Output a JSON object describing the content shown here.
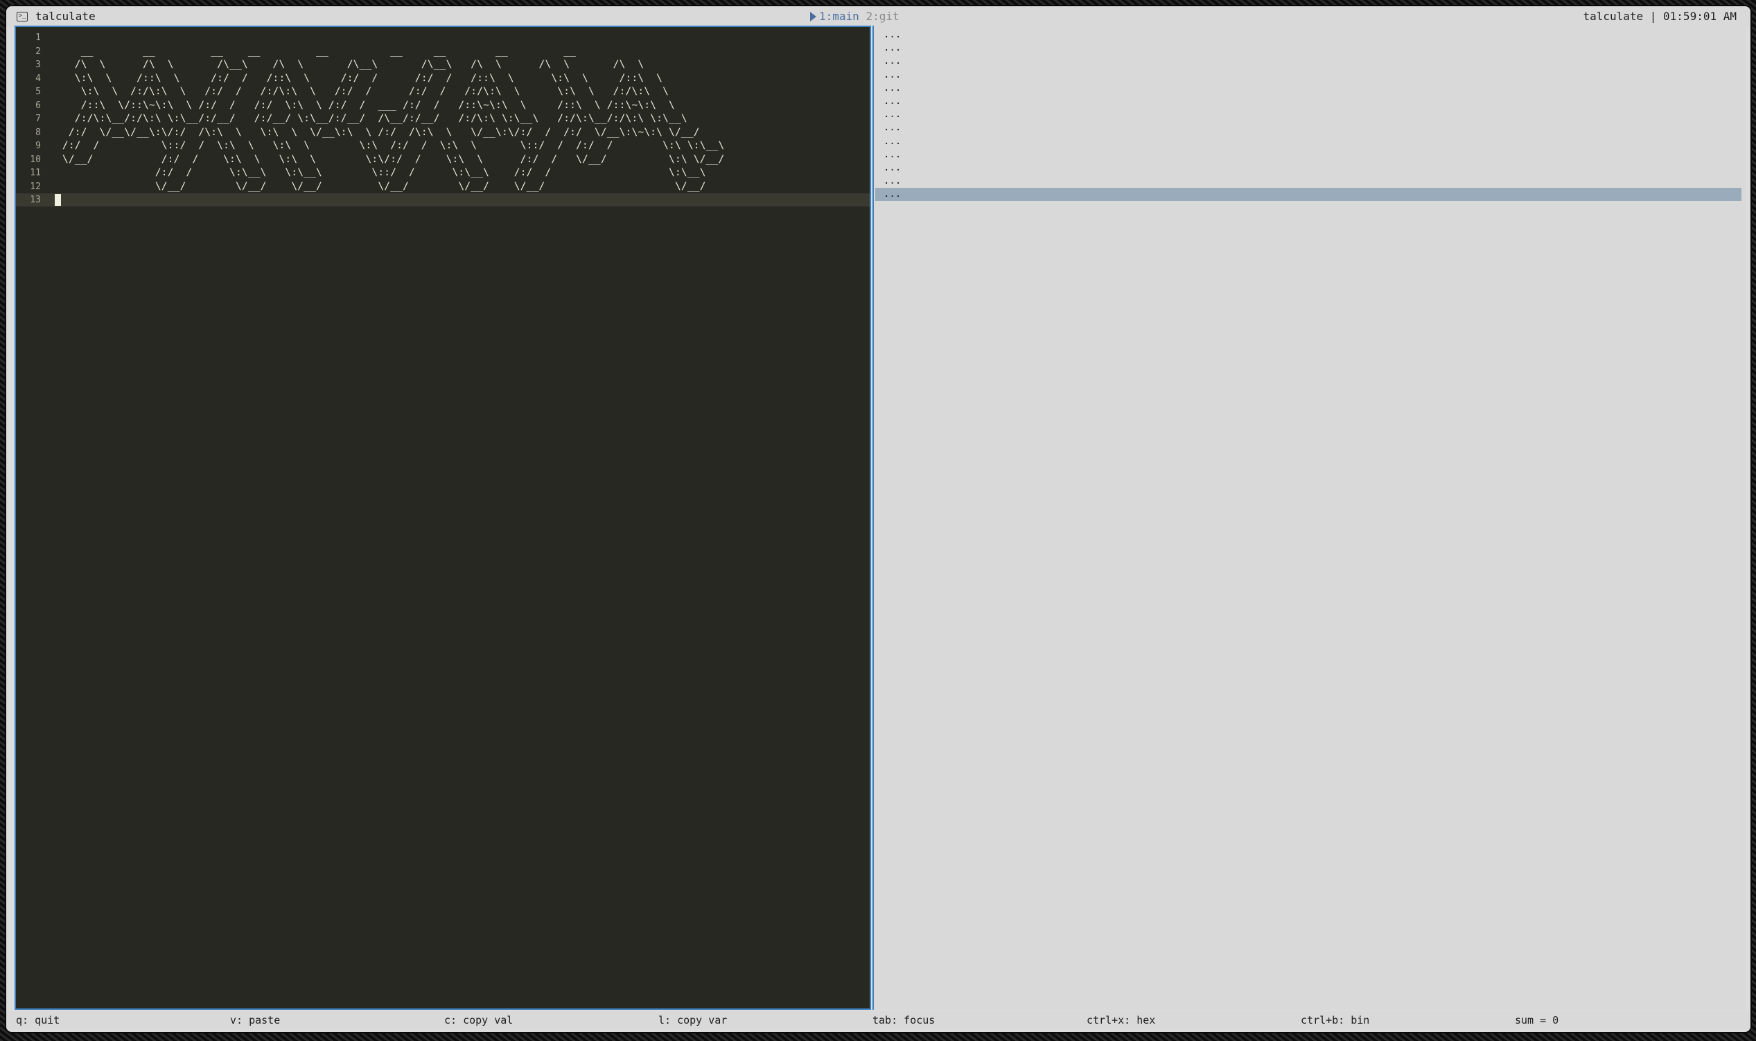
{
  "titlebar": {
    "title": "talculate",
    "tab_active": "1:main",
    "tab_inactive": "2:git",
    "right": "talculate | 01:59:01 AM"
  },
  "editor": {
    "lines": [
      {
        "num": "1",
        "text": ""
      },
      {
        "num": "2",
        "text": "    __        __         __    __         __          __     __        __         __"
      },
      {
        "num": "3",
        "text": "   /\\  \\      /\\  \\       /\\__\\    /\\  \\       /\\__\\       /\\__\\   /\\  \\      /\\  \\       /\\  \\"
      },
      {
        "num": "4",
        "text": "   \\:\\  \\    /::\\  \\     /:/  /   /::\\  \\     /:/  /      /:/  /   /::\\  \\      \\:\\  \\     /::\\  \\"
      },
      {
        "num": "5",
        "text": "    \\:\\  \\  /:/\\:\\  \\   /:/  /   /:/\\:\\  \\   /:/  /      /:/  /   /:/\\:\\  \\      \\:\\  \\   /:/\\:\\  \\"
      },
      {
        "num": "6",
        "text": "    /::\\  \\/::\\~\\:\\  \\ /:/  /   /:/  \\:\\  \\ /:/  /  ___ /:/  /   /::\\~\\:\\  \\     /::\\  \\ /::\\~\\:\\  \\"
      },
      {
        "num": "7",
        "text": "   /:/\\:\\__/:/\\:\\ \\:\\__/:/__/   /:/__/ \\:\\__/:/__/  /\\__/:/__/   /:/\\:\\ \\:\\__\\   /:/\\:\\__/:/\\:\\ \\:\\__\\"
      },
      {
        "num": "8",
        "text": "  /:/  \\/__\\/__\\:\\/:/  /\\:\\  \\   \\:\\  \\  \\/__\\:\\  \\ /:/  /\\:\\  \\   \\/__\\:\\/:/  /  /:/  \\/__\\:\\~\\:\\ \\/__/"
      },
      {
        "num": "9",
        "text": " /:/  /          \\::/  /  \\:\\  \\   \\:\\  \\        \\:\\  /:/  /  \\:\\  \\       \\::/  /  /:/  /        \\:\\ \\:\\__\\"
      },
      {
        "num": "10",
        "text": " \\/__/           /:/  /    \\:\\  \\   \\:\\  \\        \\:\\/:/  /    \\:\\  \\      /:/  /   \\/__/          \\:\\ \\/__/"
      },
      {
        "num": "11",
        "text": "                /:/  /      \\:\\__\\   \\:\\__\\        \\::/  /      \\:\\__\\    /:/  /                   \\:\\__\\"
      },
      {
        "num": "12",
        "text": "                \\/__/        \\/__/    \\/__/         \\/__/        \\/__/    \\/__/                     \\/__/"
      },
      {
        "num": "13",
        "text": ""
      }
    ]
  },
  "results": {
    "lines": [
      "...",
      "...",
      "...",
      "...",
      "...",
      "...",
      "...",
      "...",
      "...",
      "...",
      "...",
      "...",
      "..."
    ]
  },
  "statusbar": {
    "items": [
      {
        "label": "q: quit"
      },
      {
        "label": "v: paste"
      },
      {
        "label": "c: copy val"
      },
      {
        "label": "l: copy var"
      },
      {
        "label": "tab: focus"
      },
      {
        "label": "ctrl+x: hex"
      },
      {
        "label": "ctrl+b: bin"
      },
      {
        "label": "sum = 0"
      }
    ]
  },
  "colors": {
    "editor_bg": "#282822",
    "results_bg": "#d9d9d9",
    "accent_border": "#3a80c0",
    "selected_row": "#9aabbb"
  }
}
